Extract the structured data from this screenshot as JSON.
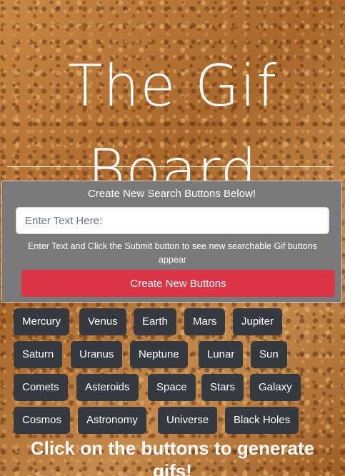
{
  "header": {
    "title_line1": "The Gif",
    "title_line2": "Board"
  },
  "form": {
    "heading": "Create New Search Buttons Below!",
    "input_placeholder": "Enter Text Here:",
    "input_value": "",
    "help_text": "Enter Text and Click the Submit button to see new searchable Gif buttons appear",
    "create_button_label": "Create New Buttons"
  },
  "gif_buttons": [
    "Mercury",
    "Venus",
    "Earth",
    "Mars",
    "Jupiter",
    "Saturn",
    "Uranus",
    "Neptune",
    "Lunar",
    "Sun",
    "Comets",
    "Asteroids",
    "Space",
    "Stars",
    "Galaxy",
    "Cosmos",
    "Astronomy",
    "Universe",
    "Black Holes"
  ],
  "footer": {
    "instruction": "Click on the buttons to generate gifs!"
  },
  "colors": {
    "panel_background": "#7a7a7a",
    "create_button": "#dc3545",
    "topic_button": "#343a40",
    "text": "#ffffff"
  }
}
